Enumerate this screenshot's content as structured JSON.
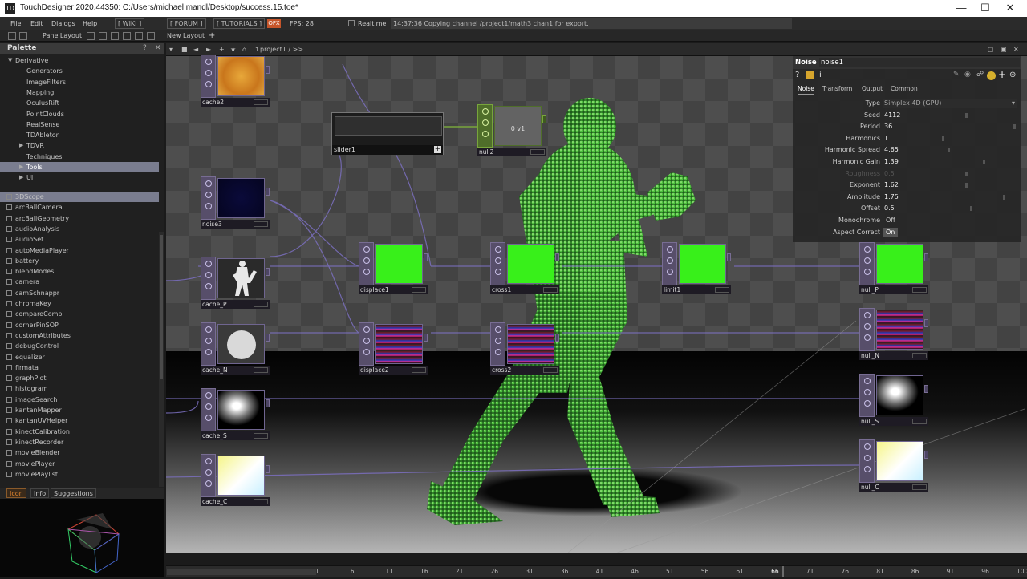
{
  "window": {
    "title": "TouchDesigner 2020.44350: C:/Users/michael mandl/Desktop/success.15.toe*",
    "logo_label": "TD",
    "controls": [
      "—",
      "☐",
      "✕"
    ]
  },
  "menu": {
    "items": [
      "File",
      "Edit",
      "Dialogs",
      "Help"
    ],
    "wiki": "[ WIKI ]",
    "forum": "[ FORUM ]",
    "tutorials": "[ TUTORIALS ]",
    "ofx": "OFX",
    "fps": "FPS: 28",
    "realtime": "Realtime",
    "status": "14:37:36 Copying channel /project1/math3 chan1 for export."
  },
  "panebar": {
    "pane_layout": "Pane Layout",
    "new_layout": "New Layout",
    "plus": "+"
  },
  "palette": {
    "title": "Palette",
    "help": "?",
    "close": "✕",
    "tree": [
      {
        "label": "Derivative",
        "arrow": "▼"
      },
      {
        "label": "Generators"
      },
      {
        "label": "ImageFilters"
      },
      {
        "label": "Mapping"
      },
      {
        "label": "OculusRift"
      },
      {
        "label": "PointClouds"
      },
      {
        "label": "RealSense"
      },
      {
        "label": "TDAbleton"
      },
      {
        "label": "TDVR",
        "arrow": "▶"
      },
      {
        "label": "Techniques"
      },
      {
        "label": "Tools",
        "arrow": "▶",
        "selected": true
      },
      {
        "label": "UI",
        "arrow": "▶"
      }
    ],
    "components": [
      "3DScope",
      "arcBallCamera",
      "arcBallGeometry",
      "audioAnalysis",
      "audioSet",
      "autoMediaPlayer",
      "battery",
      "blendModes",
      "camera",
      "camSchnappr",
      "chromaKey",
      "compareComp",
      "cornerPinSOP",
      "customAttributes",
      "debugControl",
      "equalizer",
      "firmata",
      "graphPlot",
      "histogram",
      "imageSearch",
      "kantanMapper",
      "kantanUVHelper",
      "kinectCalibration",
      "kinectRecorder",
      "movieBlender",
      "moviePlayer",
      "moviePlaylist"
    ],
    "tabs": [
      "Icon",
      "Info",
      "Suggestions"
    ]
  },
  "network": {
    "path": "project1 / >>",
    "nodes": [
      {
        "id": "cache2",
        "label": "cache2",
        "family": "top"
      },
      {
        "id": "noise3",
        "label": "noise3",
        "family": "top"
      },
      {
        "id": "cache_P",
        "label": "cache_P",
        "family": "top"
      },
      {
        "id": "cache_N",
        "label": "cache_N",
        "family": "top"
      },
      {
        "id": "cache_S",
        "label": "cache_S",
        "family": "top"
      },
      {
        "id": "cache_C",
        "label": "cache_C",
        "family": "top"
      },
      {
        "id": "displace1",
        "label": "displace1",
        "family": "top"
      },
      {
        "id": "displace2",
        "label": "displace2",
        "family": "top"
      },
      {
        "id": "cross1",
        "label": "cross1",
        "family": "top"
      },
      {
        "id": "cross2",
        "label": "cross2",
        "family": "top"
      },
      {
        "id": "limit1",
        "label": "limit1",
        "family": "top"
      },
      {
        "id": "null_P",
        "label": "null_P",
        "family": "top"
      },
      {
        "id": "null_N",
        "label": "null_N",
        "family": "top"
      },
      {
        "id": "null_S",
        "label": "null_S",
        "family": "top"
      },
      {
        "id": "null_C",
        "label": "null_C",
        "family": "top"
      },
      {
        "id": "null2",
        "label": "null2",
        "family": "chop",
        "value": "0  v1"
      },
      {
        "id": "slider1",
        "label": "slider1",
        "family": "comp"
      }
    ]
  },
  "params": {
    "op_type": "Noise",
    "op_name": "noise1",
    "tabs": [
      "Noise",
      "Transform",
      "Output",
      "Common"
    ],
    "active_tab": "Noise",
    "rows": [
      {
        "label": "Type",
        "value": "Simplex 4D (GPU)",
        "kind": "menu"
      },
      {
        "label": "Seed",
        "value": "4112",
        "kind": "slider",
        "pos": 0.5
      },
      {
        "label": "Period",
        "value": "36",
        "kind": "slider",
        "pos": 0.98
      },
      {
        "label": "Harmonics",
        "value": "1",
        "kind": "slider",
        "pos": 0.27
      },
      {
        "label": "Harmonic Spread",
        "value": "4.65",
        "kind": "slider",
        "pos": 0.33
      },
      {
        "label": "Harmonic Gain",
        "value": "1.39",
        "kind": "slider",
        "pos": 0.68
      },
      {
        "label": "Roughness",
        "value": "0.5",
        "kind": "slider",
        "pos": 0.5,
        "disabled": true
      },
      {
        "label": "Exponent",
        "value": "1.62",
        "kind": "slider",
        "pos": 0.5
      },
      {
        "label": "Amplitude",
        "value": "1.75",
        "kind": "slider",
        "pos": 0.88
      },
      {
        "label": "Offset",
        "value": "0.5",
        "kind": "slider",
        "pos": 0.55
      },
      {
        "label": "Monochrome",
        "value": "Off",
        "kind": "toggle"
      },
      {
        "label": "Aspect Correct",
        "value": "On",
        "kind": "toggle",
        "on": true
      }
    ]
  },
  "timeline": {
    "ticks": [
      "1",
      "6",
      "11",
      "16",
      "21",
      "26",
      "31",
      "36",
      "41",
      "46",
      "51",
      "56",
      "61",
      "66",
      "71",
      "76",
      "81",
      "86",
      "91",
      "96",
      "100"
    ],
    "current": "66"
  }
}
